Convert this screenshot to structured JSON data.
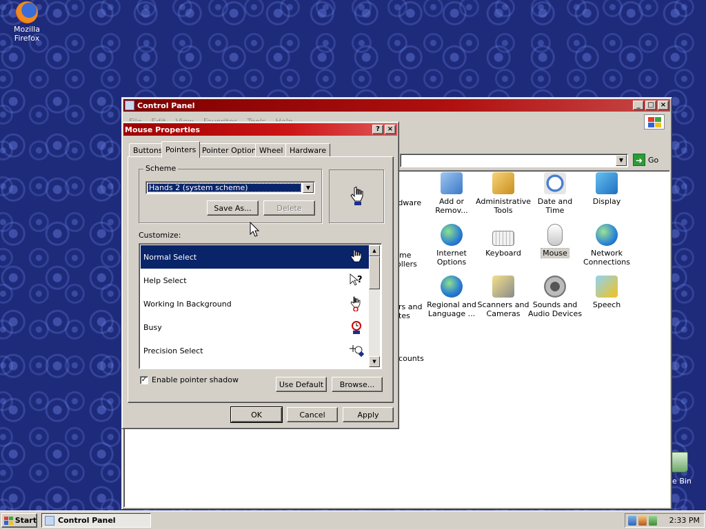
{
  "desktop": {
    "icons": [
      {
        "label": "Mozilla Firefox",
        "icon": "firefox-icon"
      }
    ],
    "recycle_bin_fragment": "le Bin"
  },
  "control_panel": {
    "title": "Control Panel",
    "menu": [
      "File",
      "Edit",
      "View",
      "Favorites",
      "Tools",
      "Help"
    ],
    "go_label": "Go",
    "items": [
      {
        "label": "Add or Remov...",
        "icon": "add-remove-programs-icon"
      },
      {
        "label": "Administrative Tools",
        "icon": "administrative-tools-icon"
      },
      {
        "label": "Date and Time",
        "icon": "date-time-icon"
      },
      {
        "label": "Display",
        "icon": "display-icon"
      },
      {
        "label": "Internet Options",
        "icon": "internet-options-icon"
      },
      {
        "label": "Keyboard",
        "icon": "keyboard-icon"
      },
      {
        "label": "Mouse",
        "icon": "mouse-icon",
        "selected": true
      },
      {
        "label": "Network Connections",
        "icon": "network-connections-icon"
      },
      {
        "label": "Regional and Language ...",
        "icon": "regional-language-icon"
      },
      {
        "label": "Scanners and Cameras",
        "icon": "scanners-cameras-icon"
      },
      {
        "label": "Sounds and Audio Devices",
        "icon": "sounds-audio-icon"
      },
      {
        "label": "Speech",
        "icon": "speech-icon"
      }
    ],
    "partial_labels": [
      "rdware",
      "me",
      "ollers",
      "rs and",
      "tes",
      "ccounts"
    ]
  },
  "mouse_properties": {
    "title": "Mouse Properties",
    "tabs": [
      "Buttons",
      "Pointers",
      "Pointer Options",
      "Wheel",
      "Hardware"
    ],
    "active_tab": "Pointers",
    "scheme_label": "Scheme",
    "scheme_value": "Hands 2 (system scheme)",
    "save_as_label": "Save As...",
    "delete_label": "Delete",
    "customize_label": "Customize:",
    "cursor_list": [
      {
        "label": "Normal Select",
        "icon": "hand-pointer-icon",
        "selected": true
      },
      {
        "label": "Help Select",
        "icon": "help-select-icon"
      },
      {
        "label": "Working In Background",
        "icon": "working-background-icon"
      },
      {
        "label": "Busy",
        "icon": "busy-icon"
      },
      {
        "label": "Precision Select",
        "icon": "precision-select-icon"
      }
    ],
    "enable_shadow_label": "Enable pointer shadow",
    "enable_shadow_checked": true,
    "use_default_label": "Use Default",
    "browse_label": "Browse...",
    "ok_label": "OK",
    "cancel_label": "Cancel",
    "apply_label": "Apply"
  },
  "taskbar": {
    "start_label": "Start",
    "task_label": "Control Panel",
    "clock": "2:33 PM"
  }
}
